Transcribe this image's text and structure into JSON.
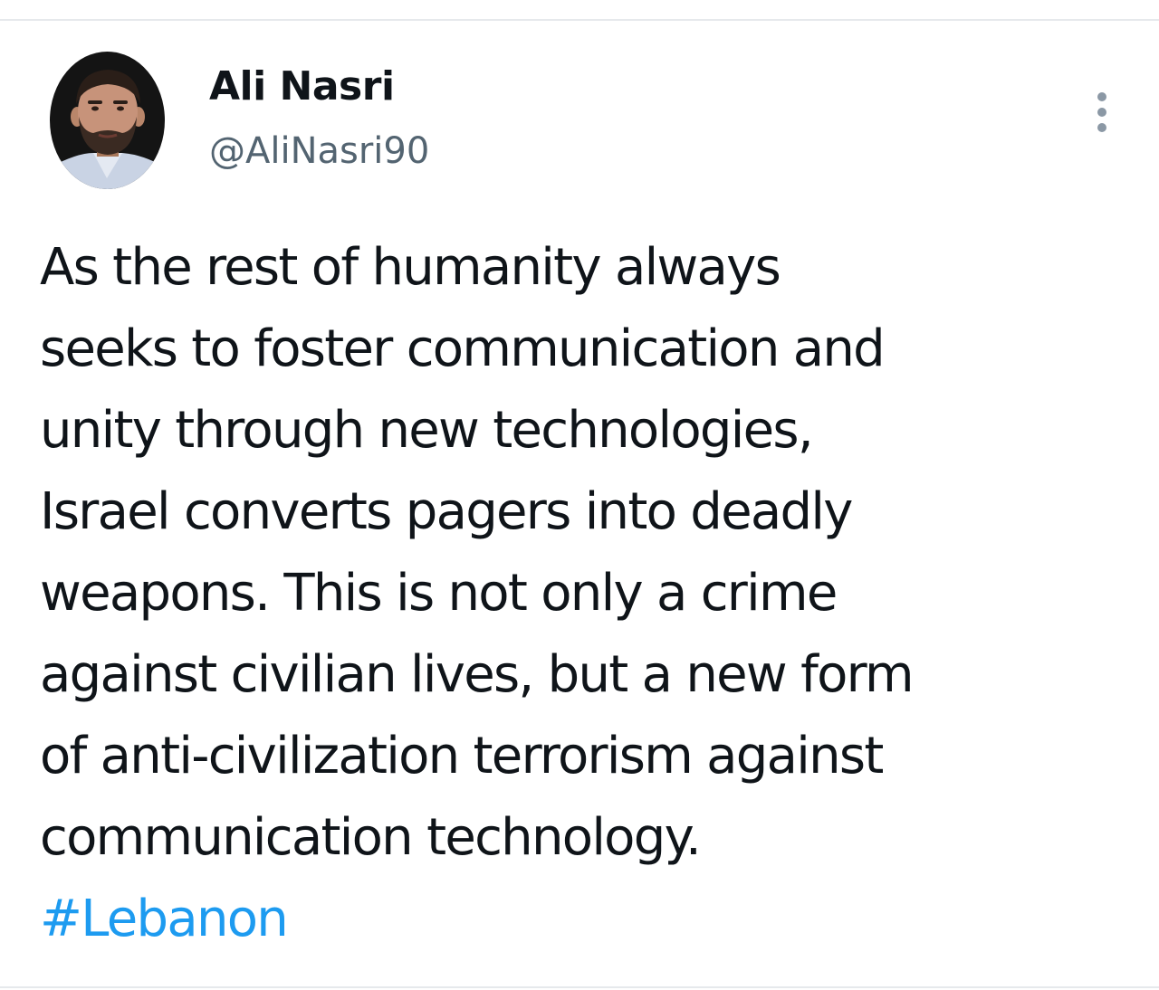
{
  "tweet": {
    "author": {
      "display_name": "Ali Nasri",
      "handle": "@AliNasri90",
      "avatar_icon": "profile-photo"
    },
    "more_icon": "more-vertical-icon",
    "text_lines": [
      "As the rest of humanity always",
      "seeks to foster communication and",
      "unity through new technologies,",
      "Israel converts pagers into deadly",
      "weapons. This is not only a crime",
      "against civilian lives, but a new form",
      "of anti-civilization terrorism against",
      "communication technology."
    ],
    "hashtag": "#Lebanon"
  },
  "colors": {
    "text": "#0f1419",
    "secondary_text": "#536471",
    "link": "#1d9bf0",
    "divider": "#e6e9ec"
  }
}
